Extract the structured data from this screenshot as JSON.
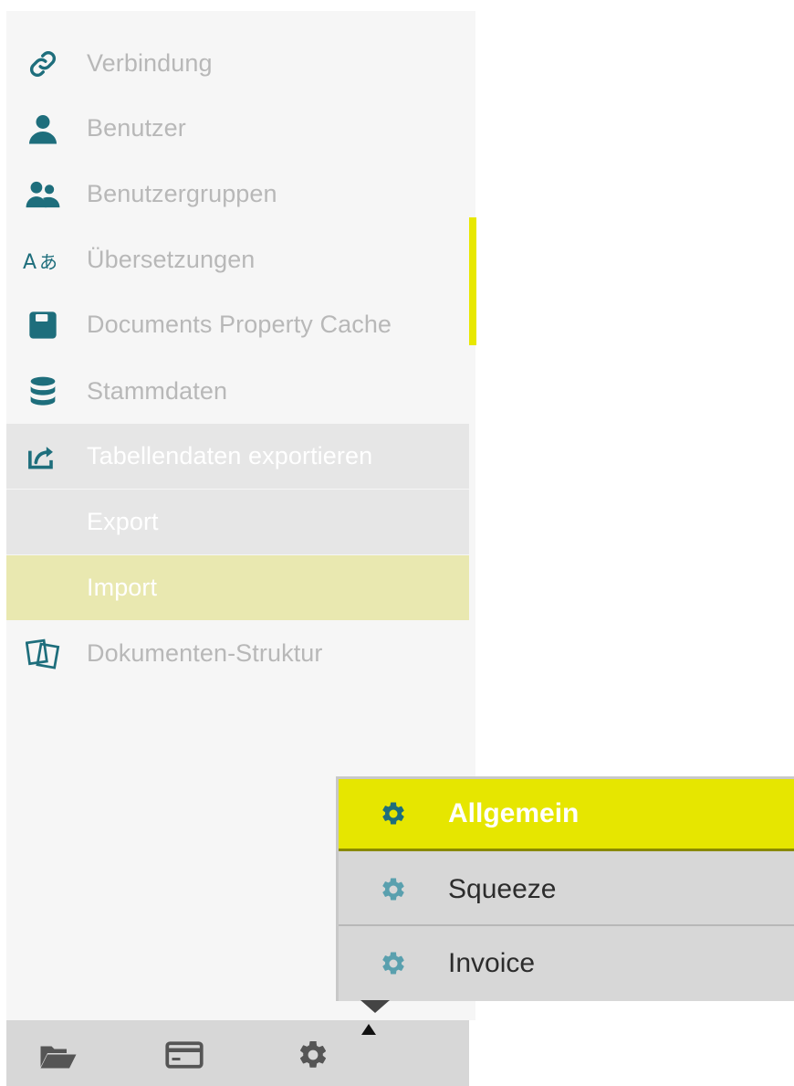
{
  "sidebar": {
    "items": [
      {
        "label": "Verbindung",
        "icon": "link-icon"
      },
      {
        "label": "Benutzer",
        "icon": "user-icon"
      },
      {
        "label": "Benutzergruppen",
        "icon": "user-group-icon"
      },
      {
        "label": "Übersetzungen",
        "icon": "translate-icon"
      },
      {
        "label": "Documents Property Cache",
        "icon": "floppy-disk-icon"
      },
      {
        "label": "Stammdaten",
        "icon": "database-icon"
      },
      {
        "label": "Tabellendaten exportieren",
        "icon": "share-export-icon"
      },
      {
        "label": "Export"
      },
      {
        "label": "Import"
      },
      {
        "label": "Dokumenten-Struktur",
        "icon": "document-structure-icon"
      }
    ]
  },
  "bottom_bar": {
    "icons": [
      "folder-open-icon",
      "card-icon",
      "gear-icon"
    ]
  },
  "popup": {
    "items": [
      {
        "label": "Allgemein",
        "icon": "gear-icon"
      },
      {
        "label": "Squeeze",
        "icon": "gear-icon"
      },
      {
        "label": "Invoice",
        "icon": "gear-icon"
      }
    ]
  },
  "colors": {
    "accent": "#e6e600",
    "icon_teal": "#1e6e7c",
    "icon_light_teal": "#5aa0ae",
    "sidebar_bg": "#f6f6f6",
    "selected_sub_bg": "#e9e8b0"
  }
}
